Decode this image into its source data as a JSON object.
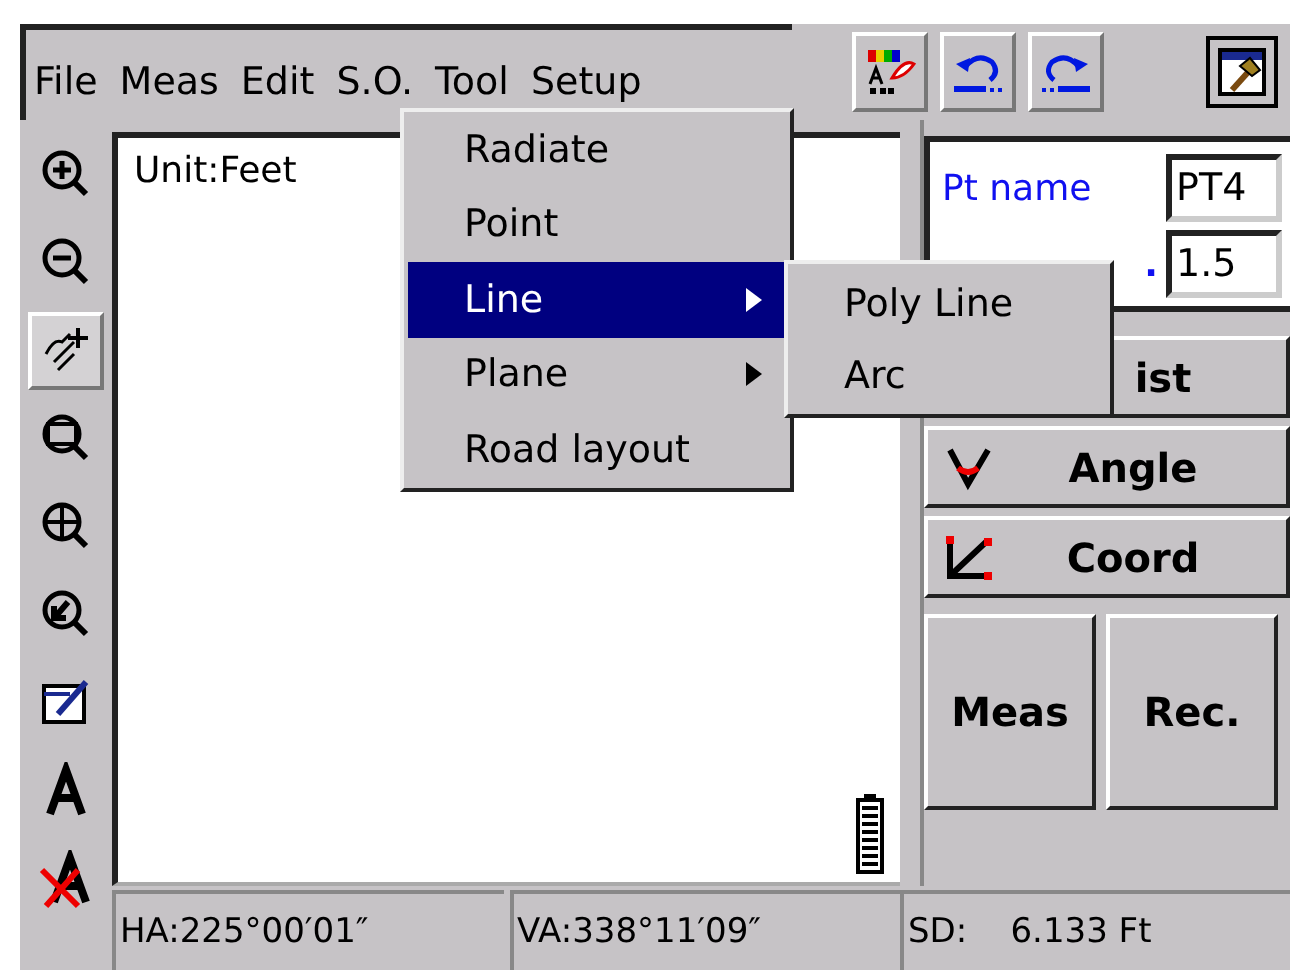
{
  "menu_bar": [
    {
      "label": "File"
    },
    {
      "label": "Meas"
    },
    {
      "label": "Edit"
    },
    {
      "label": "S.O."
    },
    {
      "label": "Tool"
    },
    {
      "label": "Setup"
    }
  ],
  "toolbar": [
    {
      "kind": "palette"
    },
    {
      "kind": "undo"
    },
    {
      "kind": "redo"
    }
  ],
  "tools": [
    {
      "kind": "zoom-in",
      "selected": false
    },
    {
      "kind": "zoom-out",
      "selected": false
    },
    {
      "kind": "pan",
      "selected": true
    },
    {
      "kind": "zoom-window",
      "selected": false
    },
    {
      "kind": "zoom-extents",
      "selected": false
    },
    {
      "kind": "zoom-point",
      "selected": false
    },
    {
      "kind": "edit",
      "selected": false
    },
    {
      "kind": "text",
      "selected": false
    },
    {
      "kind": "text-off",
      "selected": false
    }
  ],
  "canvas": {
    "unit": "Unit:Feet"
  },
  "so_menu": {
    "items": [
      {
        "label": "Radiate",
        "submenu": false,
        "selected": false
      },
      {
        "label": "Point",
        "submenu": false,
        "selected": false
      },
      {
        "label": "Line",
        "submenu": true,
        "selected": true
      },
      {
        "label": "Plane",
        "submenu": true,
        "selected": false
      },
      {
        "label": "Road layout",
        "submenu": false,
        "selected": false
      }
    ]
  },
  "submenu": {
    "items": [
      "Poly Line",
      "Arc"
    ]
  },
  "panel": {
    "fields": [
      {
        "label": "Pt name",
        "value": "PT4"
      },
      {
        "label": ".",
        "value": "1.5"
      }
    ],
    "modes": [
      {
        "label": "ist",
        "kind": "dist"
      },
      {
        "label": "Angle",
        "kind": "angle"
      },
      {
        "label": "Coord",
        "kind": "coord"
      }
    ],
    "actions": [
      "Meas",
      "Rec."
    ]
  },
  "status_bar": [
    "HA:225°00′01″",
    "VA:338°11′09″",
    "SD:    6.133 Ft"
  ]
}
